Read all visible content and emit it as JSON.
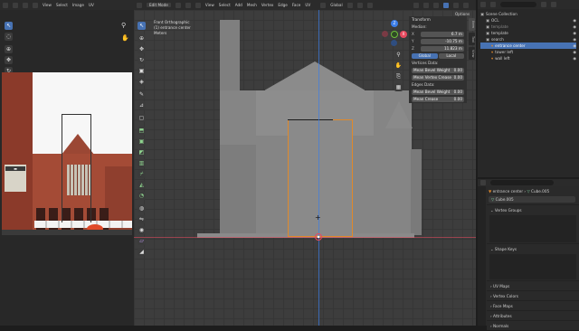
{
  "image_editor": {
    "menu": [
      "View",
      "Select",
      "Image",
      "UV"
    ],
    "tools": [
      "cursor-arrow-icon",
      "select-circle-icon",
      "cursor-icon",
      "move-icon",
      "rotate-icon",
      "scale-icon",
      "transform-icon",
      "annotate-icon",
      "ruler-icon",
      "grab-icon",
      "relax-icon",
      "pinch-icon",
      "rip-icon"
    ]
  },
  "viewport": {
    "mode": "Edit Mode",
    "menu": [
      "View",
      "Select",
      "Add",
      "Mesh",
      "Vertex",
      "Edge",
      "Face",
      "UV"
    ],
    "orientation": "Global",
    "options_label": "Options",
    "overlay_text": [
      "Front Orthographic",
      "(1) entrance center",
      "Meters"
    ],
    "gizmo_axes": [
      "X",
      "Y",
      "Z"
    ],
    "tools": [
      "select-icon",
      "cursor-icon",
      "move-icon",
      "rotate-icon",
      "scale-icon",
      "transform-icon",
      "annotate-icon",
      "measure-icon",
      "add-cube-icon",
      "extrude-icon",
      "inset-icon",
      "bevel-icon",
      "loopcut-icon",
      "knife-icon",
      "polybuild-icon",
      "spin-icon",
      "smooth-icon",
      "edge-slide-icon",
      "shrink-icon",
      "shear-icon",
      "rip-icon"
    ],
    "side_tabs": [
      "Item",
      "Tool",
      "View"
    ]
  },
  "transform_panel": {
    "title": "Transform",
    "median_label": "Median:",
    "x_label": "X",
    "x_value": "6.7 m",
    "y_label": "Y",
    "y_value": "-10.75 m",
    "z_label": "Z",
    "z_value": "11.823 m",
    "global_label": "Global",
    "local_label": "Local",
    "vertices_data_label": "Vertices Data:",
    "mean_bevel_weight_label": "Mean Bevel Weight",
    "mean_bevel_weight_value": "0.00",
    "mean_vertex_crease_label": "Mean Vertex Crease",
    "mean_vertex_crease_value": "0.00",
    "edges_data_label": "Edges Data:",
    "edge_bevel_label": "Mean Bevel Weight",
    "edge_bevel_value": "0.00",
    "edge_crease_label": "Mean Crease",
    "edge_crease_value": "0.00"
  },
  "outliner": {
    "root": "Scene Collection",
    "items": [
      {
        "name": "OCL",
        "indent": 1,
        "color": "#cfcfcf"
      },
      {
        "name": "template",
        "indent": 1,
        "color": "#8a8a8a"
      },
      {
        "name": "template",
        "indent": 1,
        "color": "#cfcfcf"
      },
      {
        "name": "search",
        "indent": 1,
        "color": "#cfcfcf"
      },
      {
        "name": "entrance center",
        "indent": 2,
        "color": "#ffffff",
        "selected": true
      },
      {
        "name": "tower left",
        "indent": 2,
        "color": "#cfcfcf"
      },
      {
        "name": "wall left",
        "indent": 2,
        "color": "#cfcfcf"
      }
    ]
  },
  "properties": {
    "object_name": "entrance center",
    "mesh_name": "Cube.005",
    "mesh_field": "Cube.005",
    "sections": [
      "Vertex Groups",
      "Shape Keys",
      "UV Maps",
      "Vertex Colors",
      "Face Maps",
      "Attributes",
      "Normals"
    ]
  },
  "colors": {
    "accent": "#4772b3",
    "selection": "#e0892a",
    "x_axis": "#e84a5f",
    "y_axis": "#6fbf3a",
    "z_axis": "#3b7de8"
  }
}
